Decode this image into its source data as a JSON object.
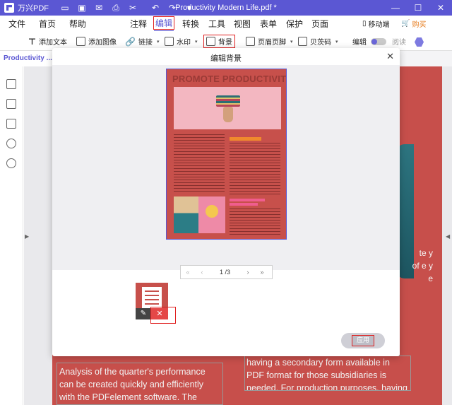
{
  "titlebar": {
    "app_name": "万兴PDF",
    "doc_title": "Productivity Modern Life.pdf *",
    "min": "—",
    "max": "☐",
    "close": "✕"
  },
  "menu": {
    "items": [
      "文件",
      "首页",
      "帮助",
      "注释",
      "编辑",
      "转换",
      "工具",
      "视图",
      "表单",
      "保护",
      "页面"
    ],
    "active": "编辑",
    "mobile": "移动端",
    "buy": "购买"
  },
  "toolbar": {
    "add_text": "添加文本",
    "add_image": "添加图像",
    "link": "链接",
    "watermark": "水印",
    "background": "背景",
    "header_footer": "页眉页脚",
    "bates": "贝茨码",
    "edit": "编辑",
    "read": "阅读"
  },
  "doc_tab": "Productivity ...e",
  "modal": {
    "title": "编辑背景",
    "preview_title": "PROMOTE PRODUCTIVITY",
    "pager_first": "«",
    "pager_prev": "‹",
    "pager_page": "1 /3",
    "pager_next": "›",
    "pager_last": "»",
    "apply": "应用"
  },
  "bg_text": {
    "right_letters": "te y of e y e",
    "bottom_left": "Analysis of the quarter's performance can be created quickly and efficiently with the PDFelement software. The software allows",
    "bottom_right": "having a secondary form available in PDF format for those subsidiaries is needed. For production purposes, having this PDF on hand"
  }
}
